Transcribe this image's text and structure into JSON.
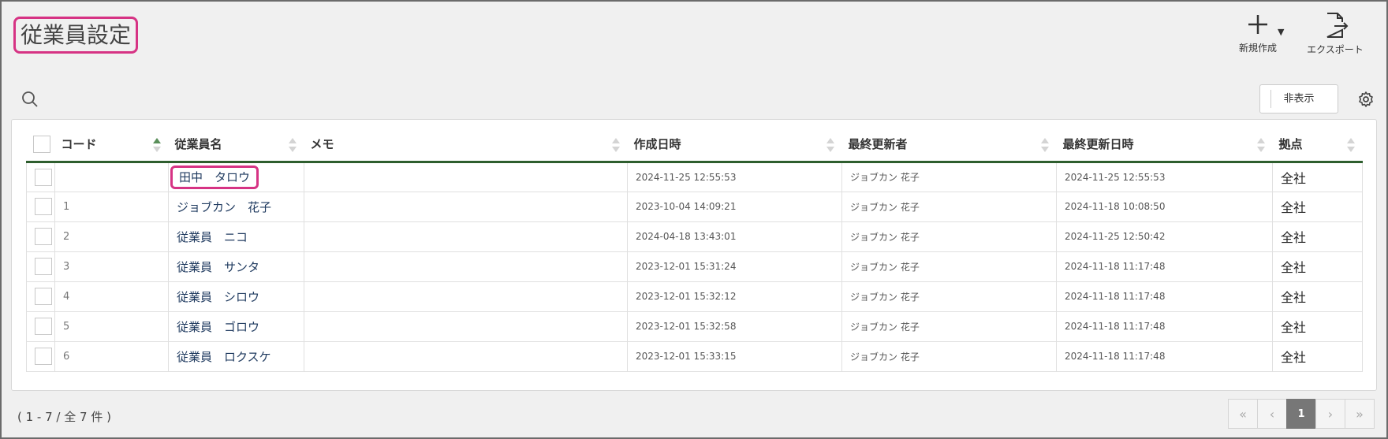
{
  "header": {
    "title": "従業員設定",
    "new_label": "新規作成",
    "export_label": "エクスポート"
  },
  "toolbar": {
    "hide_label": "非表示"
  },
  "table": {
    "columns": [
      "コード",
      "従業員名",
      "メモ",
      "作成日時",
      "最終更新者",
      "最終更新日時",
      "拠点"
    ],
    "rows": [
      {
        "code": "",
        "name": "田中　タロウ",
        "memo": "",
        "created": "2024-11-25 12:55:53",
        "updater": "ジョブカン 花子",
        "updated": "2024-11-25 12:55:53",
        "base": "全社"
      },
      {
        "code": "1",
        "name": "ジョブカン　花子",
        "memo": "",
        "created": "2023-10-04 14:09:21",
        "updater": "ジョブカン 花子",
        "updated": "2024-11-18 10:08:50",
        "base": "全社"
      },
      {
        "code": "2",
        "name": "従業員　ニコ",
        "memo": "",
        "created": "2024-04-18 13:43:01",
        "updater": "ジョブカン 花子",
        "updated": "2024-11-25 12:50:42",
        "base": "全社"
      },
      {
        "code": "3",
        "name": "従業員　サンタ",
        "memo": "",
        "created": "2023-12-01 15:31:24",
        "updater": "ジョブカン 花子",
        "updated": "2024-11-18 11:17:48",
        "base": "全社"
      },
      {
        "code": "4",
        "name": "従業員　シロウ",
        "memo": "",
        "created": "2023-12-01 15:32:12",
        "updater": "ジョブカン 花子",
        "updated": "2024-11-18 11:17:48",
        "base": "全社"
      },
      {
        "code": "5",
        "name": "従業員　ゴロウ",
        "memo": "",
        "created": "2023-12-01 15:32:58",
        "updater": "ジョブカン 花子",
        "updated": "2024-11-18 11:17:48",
        "base": "全社"
      },
      {
        "code": "6",
        "name": "従業員　ロクスケ",
        "memo": "",
        "created": "2023-12-01 15:33:15",
        "updater": "ジョブカン 花子",
        "updated": "2024-11-18 11:17:48",
        "base": "全社"
      }
    ]
  },
  "footer": {
    "count_text": "( 1 - 7 / 全 7 件 )",
    "pager": {
      "first": "«",
      "prev": "‹",
      "current": "1",
      "next": "›",
      "last": "»"
    }
  },
  "colors": {
    "highlight": "#d63384",
    "header_rule": "#2e5e2e"
  }
}
